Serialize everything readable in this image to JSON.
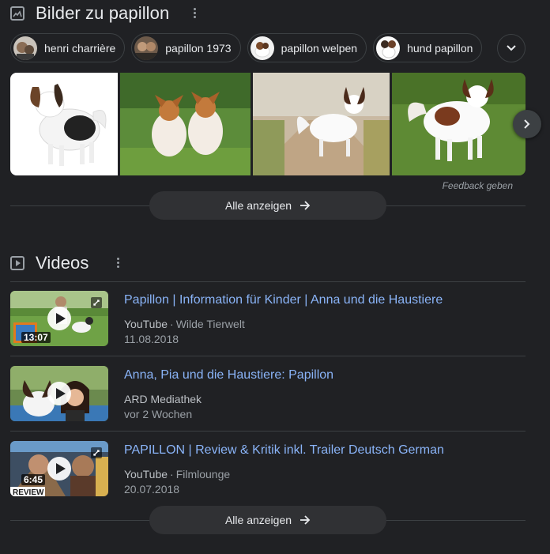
{
  "images_section": {
    "title": "Bilder zu papillon",
    "chips": [
      {
        "label": "henri charrière"
      },
      {
        "label": "papillon 1973"
      },
      {
        "label": "papillon welpen"
      },
      {
        "label": "hund papillon"
      }
    ],
    "feedback": "Feedback geben",
    "show_all": "Alle anzeigen"
  },
  "videos_section": {
    "title": "Videos",
    "items": [
      {
        "title": "Papillon | Information für Kinder | Anna und die Haustiere",
        "source": "YouTube",
        "channel": "Wilde Tierwelt",
        "date": "11.08.2018",
        "duration": "13:07"
      },
      {
        "title": "Anna, Pia und die Haustiere: Papillon",
        "source": "ARD Mediathek",
        "channel": "",
        "date": "vor 2 Wochen",
        "duration": ""
      },
      {
        "title": "PAPILLON | Review & Kritik inkl. Trailer Deutsch German",
        "source": "YouTube",
        "channel": "Filmlounge",
        "date": "20.07.2018",
        "duration": "6:45",
        "badge": "REVIEW"
      }
    ],
    "show_all": "Alle anzeigen"
  },
  "colors": {
    "background": "#202124",
    "link": "#8ab4f8",
    "pill": "#303134",
    "border": "#3c4043"
  }
}
